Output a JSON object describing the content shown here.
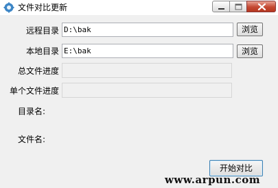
{
  "window": {
    "title": "文件对比更新",
    "icon": "gear-app-icon",
    "controls": {
      "minimize": "minimize-icon",
      "maximize": "maximize-icon",
      "close": "close-icon"
    }
  },
  "form": {
    "remote_dir": {
      "label": "远程目录",
      "value": "D:\\bak",
      "browse_label": "浏览"
    },
    "local_dir": {
      "label": "本地目录",
      "value": "E:\\bak",
      "browse_label": "浏览"
    },
    "total_progress": {
      "label": "总文件进度"
    },
    "file_progress": {
      "label": "单个文件进度"
    },
    "dir_name": {
      "label": "目录名:"
    },
    "file_name": {
      "label": "文件名:"
    }
  },
  "actions": {
    "start_label": "开始对比"
  },
  "watermark": "www.arpun.com",
  "colors": {
    "close_button": "#c44933",
    "background": "#f0f0f0"
  }
}
